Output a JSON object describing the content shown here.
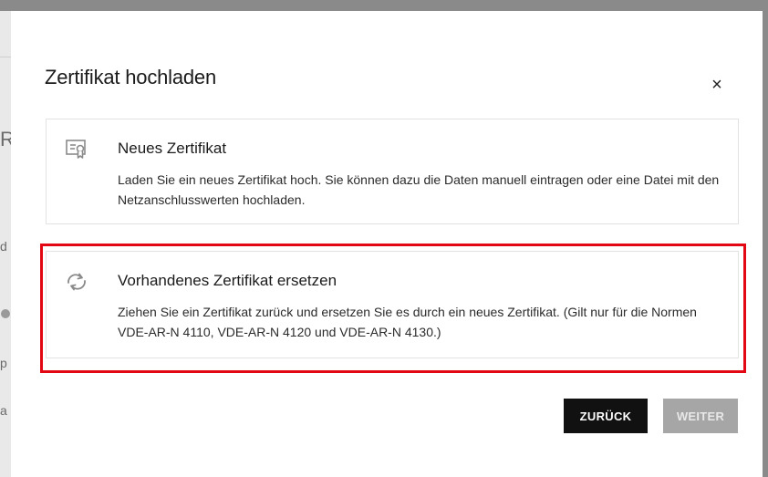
{
  "background": {
    "fragments": [
      "R",
      "d",
      "p",
      "a"
    ]
  },
  "dialog": {
    "title": "Zertifikat hochladen",
    "close_label": "×",
    "options": [
      {
        "title": "Neues Zertifikat",
        "description": "Laden Sie ein neues Zertifikat hoch. Sie können dazu die Daten manuell eintragen oder eine Datei mit den Netzanschlusswerten hochladen.",
        "icon": "certificate-icon",
        "highlighted": false
      },
      {
        "title": "Vorhandenes Zertifikat ersetzen",
        "description": "Ziehen Sie ein Zertifikat zurück und ersetzen Sie es durch ein neues Zertifikat. (Gilt nur für die Normen VDE-AR-N 4110, VDE-AR-N 4120 und VDE-AR-N 4130.)",
        "icon": "replace-arrows-icon",
        "highlighted": true,
        "highlight_color": "#e30613"
      }
    ],
    "buttons": {
      "back": "ZURÜCK",
      "next": "WEITER"
    }
  }
}
